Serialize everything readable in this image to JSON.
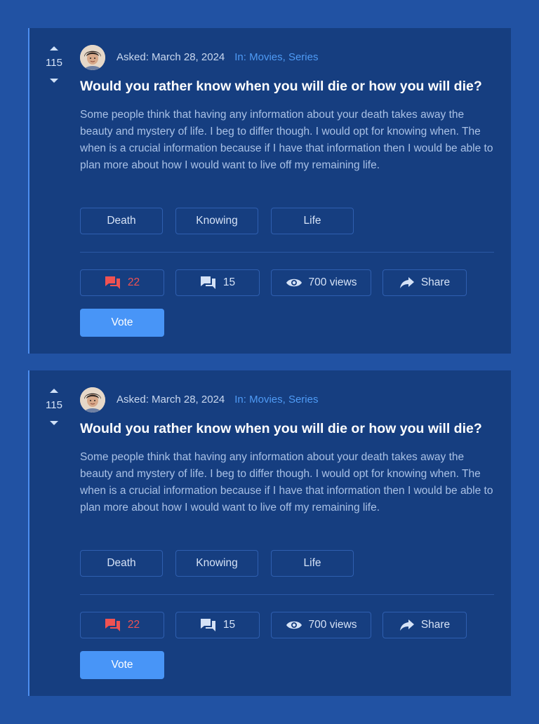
{
  "questions": [
    {
      "votes": "115",
      "asked": "Asked: March 28, 2024",
      "categories": "In: Movies, Series",
      "title": "Would you rather know when you will die or how you will die?",
      "body": "Some people think that having any information about your death takes away the beauty and mystery of life. I beg to differ though. I would opt for knowing when. The when is a crucial information because if I have that information then I would be able to plan more about how I would want to live off my remaining life.",
      "tags": [
        "Death",
        "Knowing",
        "Life"
      ],
      "answers": "22",
      "comments": "15",
      "views": "700 views",
      "share": "Share",
      "vote_label": "Vote"
    },
    {
      "votes": "115",
      "asked": "Asked: March 28, 2024",
      "categories": "In: Movies, Series",
      "title": "Would you rather know when you will die or how you will die?",
      "body": "Some people think that having any information about your death takes away the beauty and mystery of life. I beg to differ though. I would opt for knowing when. The when is a crucial information because if I have that information then I would be able to plan more about how I would want to live off my remaining life.",
      "tags": [
        "Death",
        "Knowing",
        "Life"
      ],
      "answers": "22",
      "comments": "15",
      "views": "700 views",
      "share": "Share",
      "vote_label": "Vote"
    }
  ],
  "colors": {
    "page_bg": "#2152a3",
    "card_bg": "#163e80",
    "accent": "#4895f7",
    "category_link": "#4f9bf5",
    "answers_red": "#f05252"
  },
  "icons": {
    "upvote": "caret-up-icon",
    "downvote": "caret-down-icon",
    "answers": "forum-icon",
    "comments": "comment-icon",
    "views": "eye-icon",
    "share": "share-arrow-icon"
  }
}
